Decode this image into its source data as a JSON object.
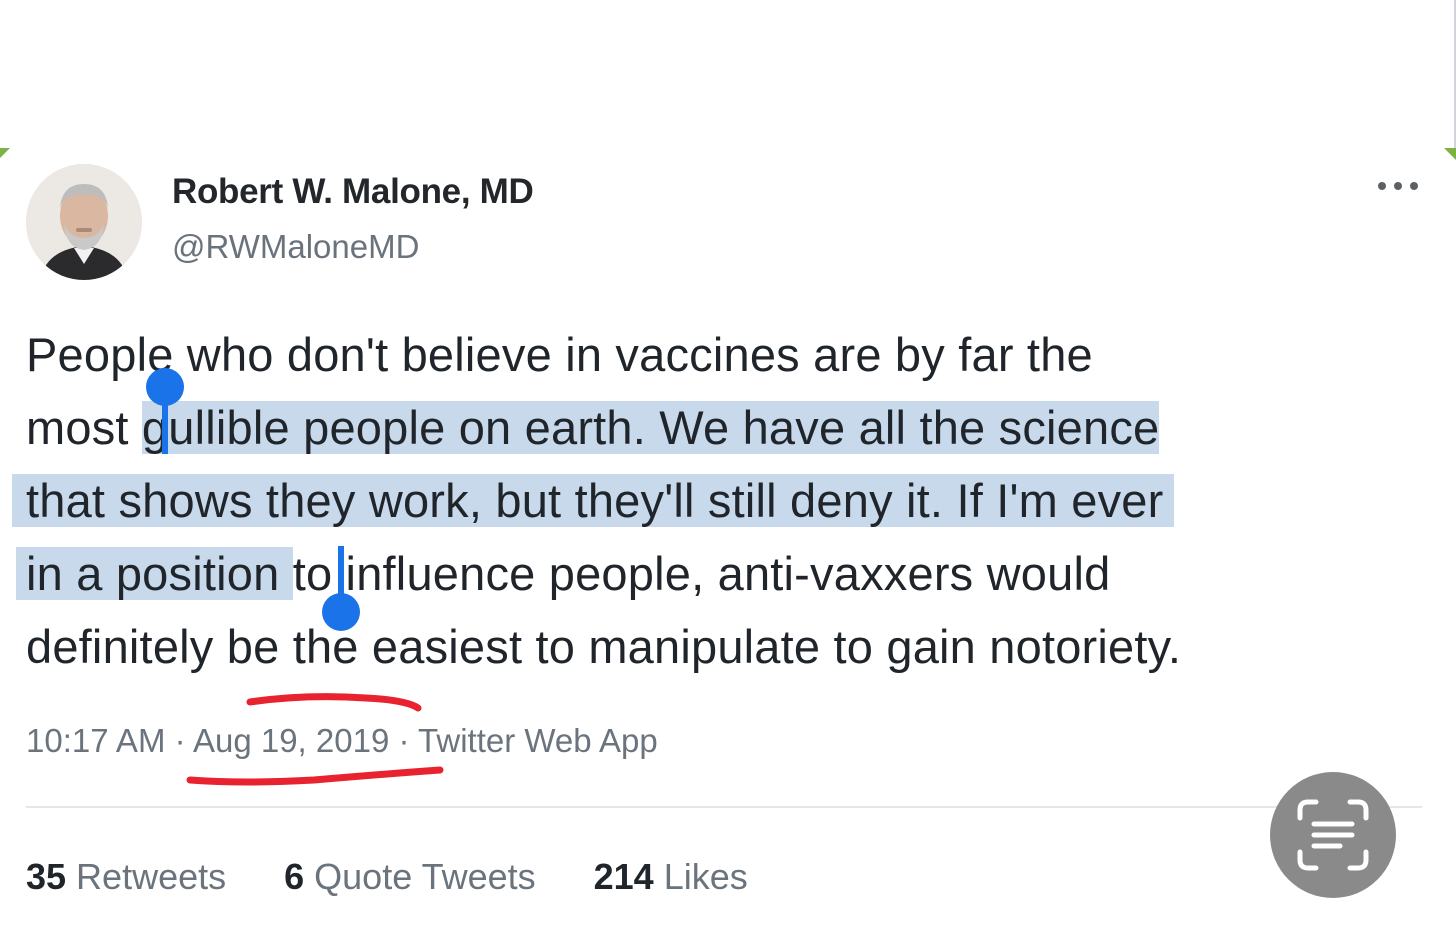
{
  "author": {
    "name": "Robert W. Malone, MD",
    "handle": "@RWMaloneMD"
  },
  "more_icon": "more-horizontal-icon",
  "tweet": {
    "lines": [
      {
        "plain_before": "People who don't believe in vaccines are by far the",
        "highlighted": "",
        "plain_after": ""
      },
      {
        "plain_before": "most ",
        "highlighted": "gullible people on earth. We have all the science",
        "plain_after": ""
      },
      {
        "plain_before": "",
        "highlighted": "that shows they work, but they'll still deny it. If I'm ever",
        "plain_after": ""
      },
      {
        "plain_before": "",
        "highlighted": "in a position ",
        "plain_after": "to influence people, anti-vaxxers would"
      },
      {
        "plain_before": "definitely be the easiest to manipulate to gain notoriety.",
        "highlighted": "",
        "plain_after": ""
      }
    ],
    "highlight_color": "#c8d9ec"
  },
  "meta": {
    "time": "10:17 AM",
    "separator": " · ",
    "date": "Aug 19, 2019",
    "source": "Twitter Web App"
  },
  "stats": {
    "retweets_count": "35",
    "retweets_label": "Retweets",
    "quotes_count": "6",
    "quotes_label": "Quote Tweets",
    "likes_count": "214",
    "likes_label": "Likes"
  },
  "colors": {
    "selection_handle": "#1a73e8",
    "annotation_underline": "#e8232f",
    "scan_button": "#8a8a8a"
  },
  "scan_icon": "text-scan-icon"
}
